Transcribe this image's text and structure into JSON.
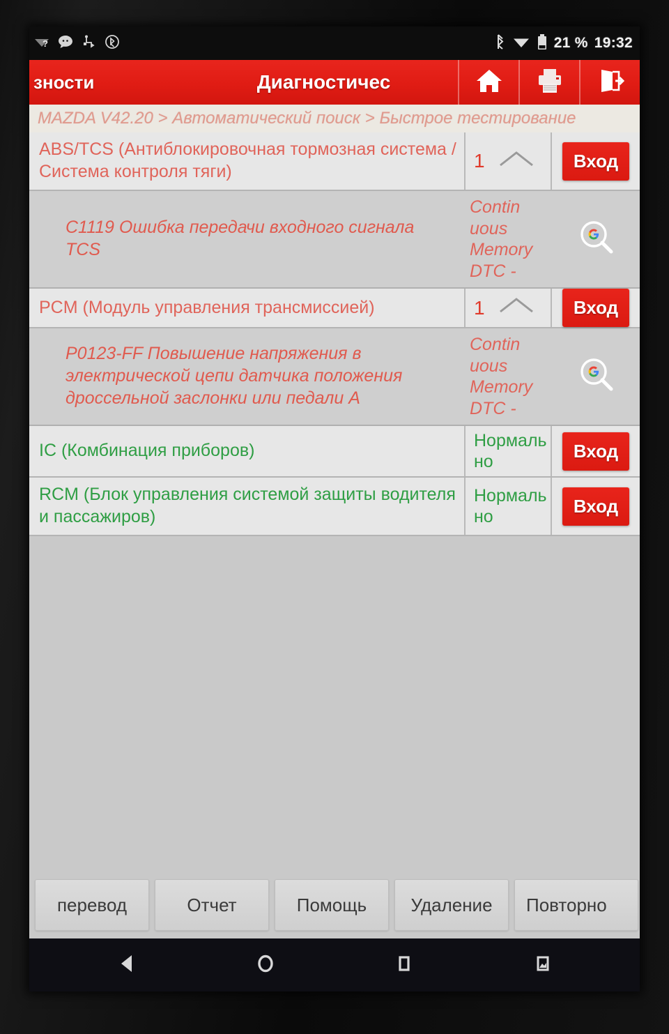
{
  "statusbar": {
    "left_icons": [
      "wifi-unknown-icon",
      "message-icon",
      "usb-icon",
      "bluetooth-circle-icon"
    ],
    "right_icons": [
      "bluetooth-icon",
      "wifi-icon",
      "battery-icon"
    ],
    "battery": "21 %",
    "time": "19:32"
  },
  "appbar": {
    "left_label": "зности",
    "title": "Диагностичес",
    "buttons": [
      {
        "name": "home-icon",
        "label": "home"
      },
      {
        "name": "print-icon",
        "label": "print"
      },
      {
        "name": "exit-icon",
        "label": "exit"
      }
    ]
  },
  "breadcrumb": "MAZDA V42.20 > Автоматический поиск > Быстрое тестирование",
  "colors": {
    "accent_red": "#e0201a",
    "fault_red": "#e0645a",
    "ok_green": "#2f9e44",
    "breadcrumb": "#e09a8e"
  },
  "list": [
    {
      "type": "module",
      "name": "ABS/TCS (Антиблокировочная тормозная система / Система контроля тяги)",
      "status": "fault",
      "count": "1",
      "chevron": "chevron-up-icon",
      "action": "Вход"
    },
    {
      "type": "dtc",
      "code_text": "C1119 Ошибка передачи входного сигнала TCS",
      "status": "Contin uous Memory DTC -",
      "status_lines": [
        "Contin",
        "uous",
        "Memory",
        "DTC -"
      ],
      "search_icon": "google-search-icon"
    },
    {
      "type": "module",
      "name": "PCM (Модуль управления трансмиссией)",
      "status": "fault",
      "count": "1",
      "chevron": "chevron-up-icon",
      "action": "Вход"
    },
    {
      "type": "dtc",
      "code_text": "P0123-FF Повышение напряжения в электрической цепи датчика положения дроссельной заслонки или педали A",
      "status": "Contin uous Memory DTC -",
      "status_lines": [
        "Contin",
        "uous",
        "Memory",
        "DTC -"
      ],
      "search_icon": "google-search-icon"
    },
    {
      "type": "module",
      "name": "IC (Комбинация приборов)",
      "status": "normal",
      "status_text": "Нормально",
      "action": "Вход"
    },
    {
      "type": "module",
      "name": "RCM (Блок управления системой защиты водителя и пассажиров)",
      "status": "normal",
      "status_text": "Нормально",
      "action": "Вход"
    }
  ],
  "toolbar": [
    {
      "label": "перевод"
    },
    {
      "label": "Отчет"
    },
    {
      "label": "Помощь"
    },
    {
      "label": "Удаление"
    },
    {
      "label": "Повторно"
    }
  ],
  "navbar": [
    {
      "name": "nav-back-icon"
    },
    {
      "name": "nav-home-icon"
    },
    {
      "name": "nav-recents-icon"
    },
    {
      "name": "nav-screenshot-icon"
    }
  ]
}
